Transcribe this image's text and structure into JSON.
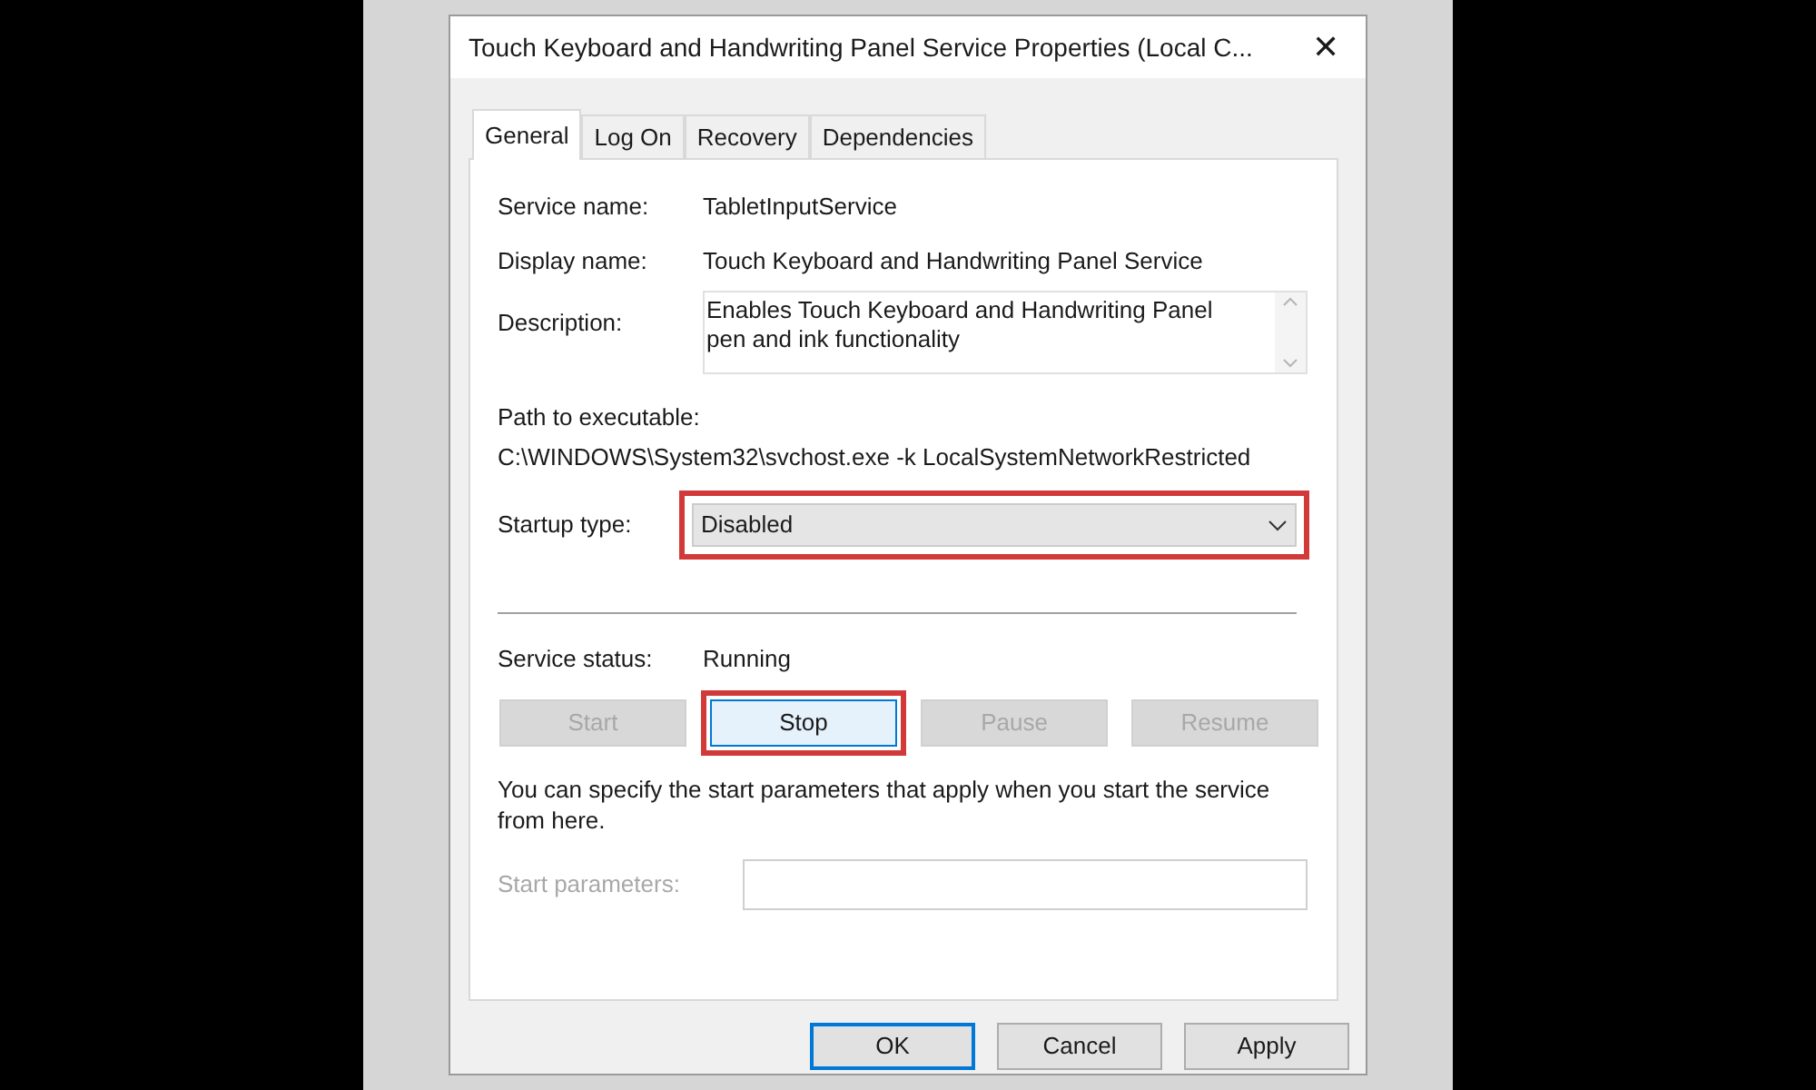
{
  "window": {
    "title": "Touch Keyboard and Handwriting Panel Service Properties (Local C...",
    "close": "✕"
  },
  "tabs": [
    {
      "label": "General",
      "selected": true
    },
    {
      "label": "Log On",
      "selected": false
    },
    {
      "label": "Recovery",
      "selected": false
    },
    {
      "label": "Dependencies",
      "selected": false
    }
  ],
  "service_name": {
    "label": "Service name:",
    "value": "TabletInputService"
  },
  "display_name": {
    "label": "Display name:",
    "value": "Touch Keyboard and Handwriting Panel Service"
  },
  "description": {
    "label": "Description:",
    "value": "Enables Touch Keyboard and Handwriting Panel pen and ink functionality"
  },
  "path": {
    "label": "Path to executable:",
    "value": "C:\\WINDOWS\\System32\\svchost.exe -k LocalSystemNetworkRestricted"
  },
  "startup_type": {
    "label": "Startup type:",
    "value": "Disabled",
    "highlighted": true
  },
  "service_status": {
    "label": "Service status:",
    "value": "Running"
  },
  "control_buttons": [
    {
      "label": "Start",
      "disabled": true,
      "highlighted": false
    },
    {
      "label": "Stop",
      "disabled": false,
      "highlighted": true
    },
    {
      "label": "Pause",
      "disabled": true,
      "highlighted": false
    },
    {
      "label": "Resume",
      "disabled": true,
      "highlighted": false
    }
  ],
  "hint": "You can specify the start parameters that apply when you start the service from here.",
  "start_parameters": {
    "label": "Start parameters:",
    "disabled": true
  },
  "buttons": [
    {
      "label": "OK",
      "selected": true
    },
    {
      "label": "Cancel",
      "selected": false
    },
    {
      "label": "Apply",
      "selected": false
    }
  ]
}
